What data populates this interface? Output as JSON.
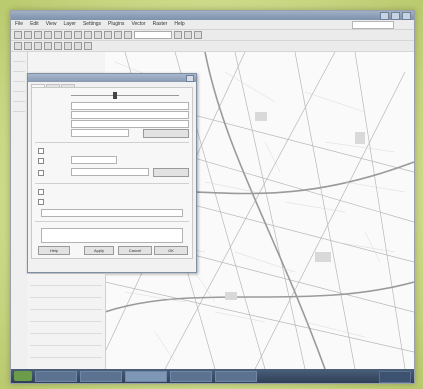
{
  "app": {
    "title": "",
    "menus": [
      "File",
      "Edit",
      "View",
      "Layer",
      "Settings",
      "Plugins",
      "Vector",
      "Raster",
      "Help"
    ],
    "search_placeholder": ""
  },
  "dialog": {
    "title": "",
    "tabs": [
      "",
      "",
      ""
    ],
    "fields": [
      {
        "label": "",
        "value": ""
      },
      {
        "label": "",
        "value": ""
      },
      {
        "label": "",
        "value": ""
      },
      {
        "label": "",
        "value": ""
      },
      {
        "label": "",
        "value": ""
      },
      {
        "label": "",
        "value": ""
      }
    ],
    "buttons": [
      "OK",
      "Cancel",
      "Apply",
      "Help"
    ]
  },
  "colors": {
    "background": "#cfdc8c",
    "window_title": "#8899b1",
    "taskbar": "#2f3f56"
  }
}
